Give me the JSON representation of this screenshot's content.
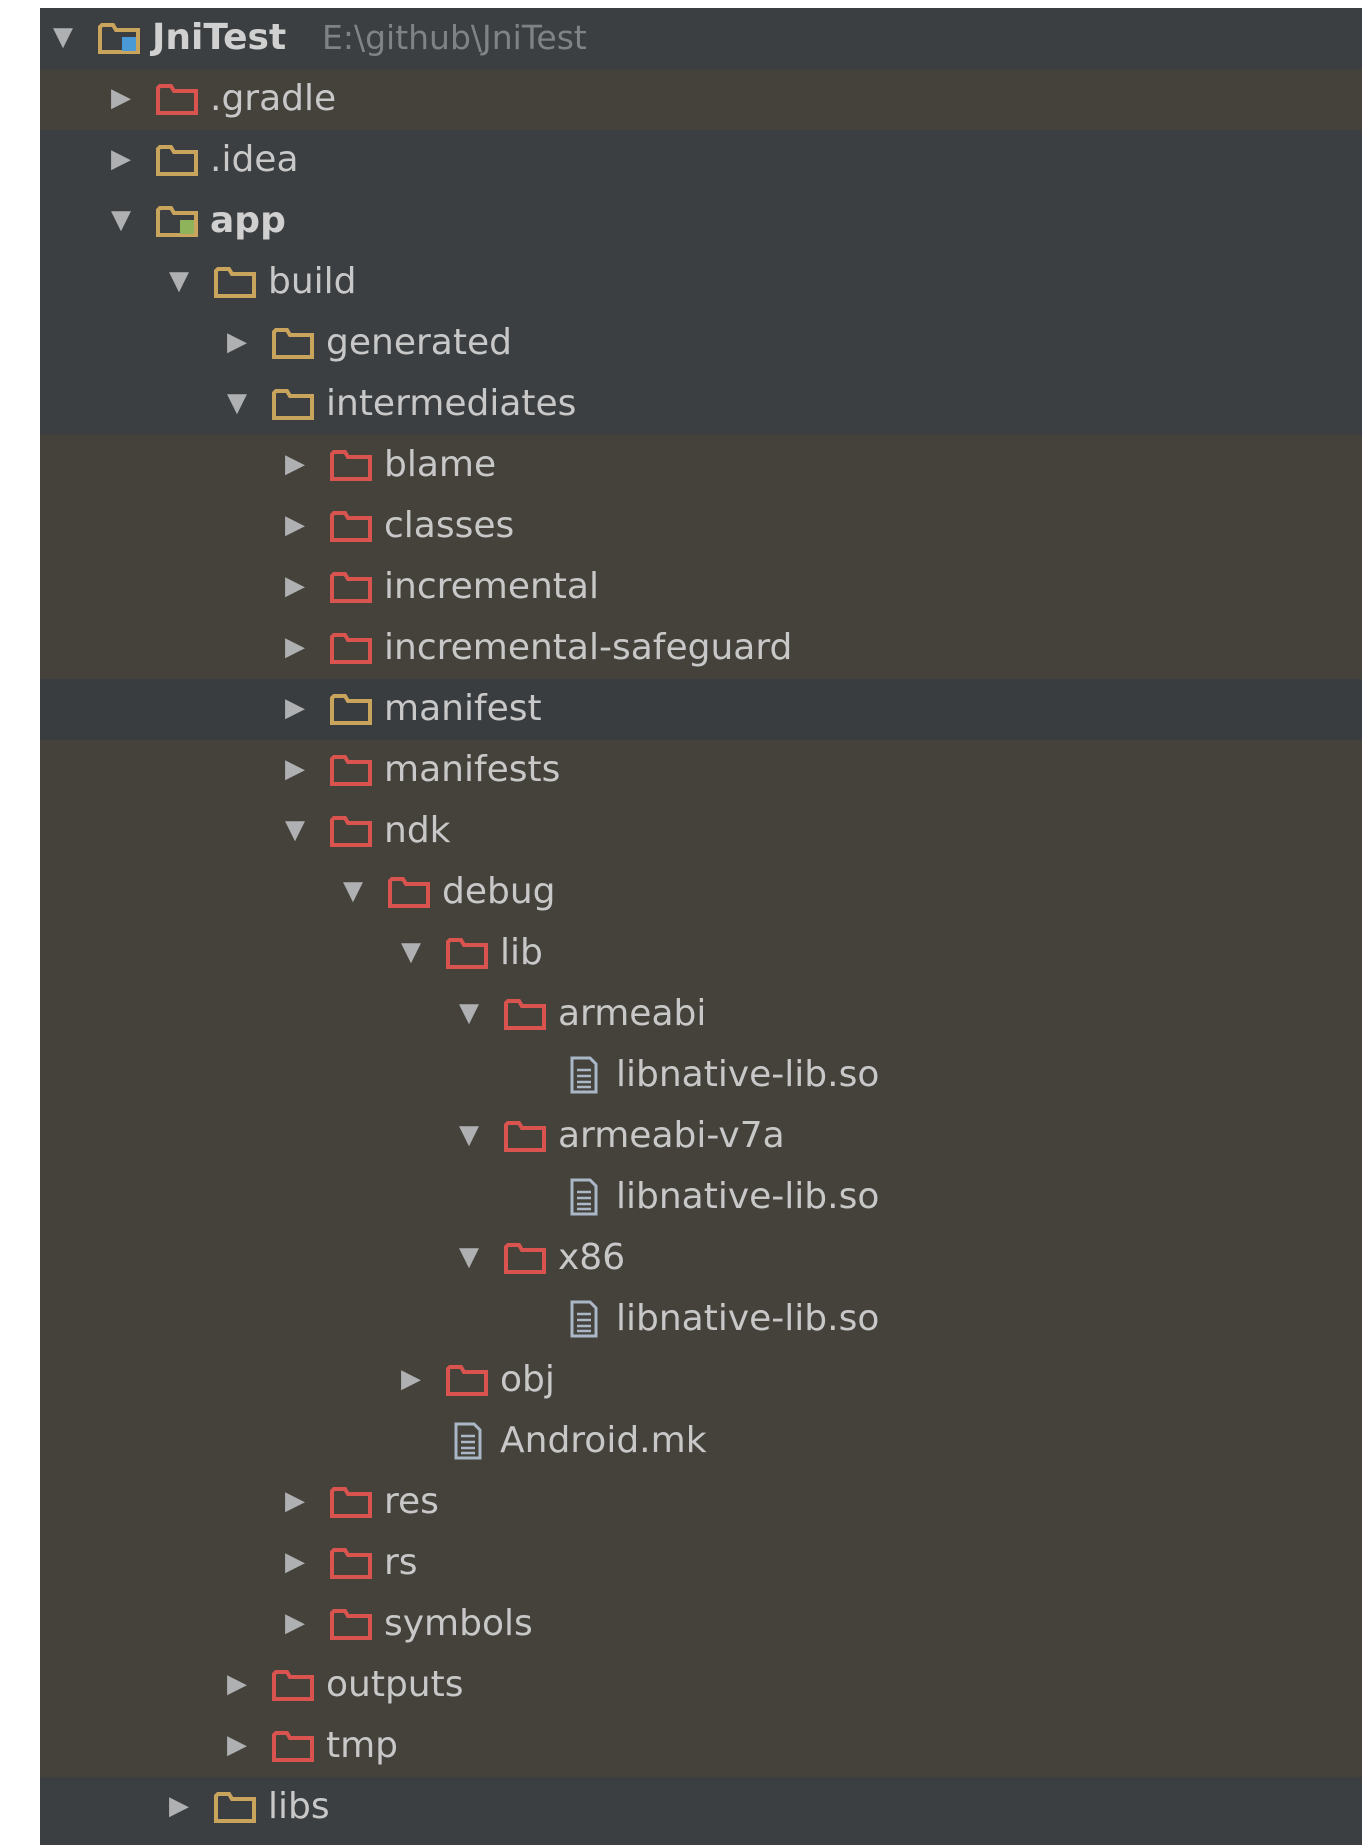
{
  "project": {
    "name": "JniTest",
    "path": "E:\\github\\JniTest"
  },
  "colors": {
    "panel_bg": "#3c3f41",
    "tint_bg": "#45423b",
    "folder_plain": "#c9a45c",
    "folder_excluded": "#d9534f",
    "file_icon": "#a9b7c6",
    "highlight_border": "#c0392b"
  },
  "tree": [
    {
      "label": "JniTest",
      "depth": 0,
      "state": "expanded",
      "icon": "project-module-icon",
      "bold": true
    },
    {
      "label": ".gradle",
      "depth": 1,
      "state": "collapsed",
      "icon": "folder-excluded-icon"
    },
    {
      "label": ".idea",
      "depth": 1,
      "state": "collapsed",
      "icon": "folder-icon"
    },
    {
      "label": "app",
      "depth": 1,
      "state": "expanded",
      "icon": "android-module-icon",
      "bold": true
    },
    {
      "label": "build",
      "depth": 2,
      "state": "expanded",
      "icon": "folder-icon"
    },
    {
      "label": "generated",
      "depth": 3,
      "state": "collapsed",
      "icon": "folder-icon"
    },
    {
      "label": "intermediates",
      "depth": 3,
      "state": "expanded",
      "icon": "folder-icon"
    },
    {
      "label": "blame",
      "depth": 4,
      "state": "collapsed",
      "icon": "folder-excluded-icon"
    },
    {
      "label": "classes",
      "depth": 4,
      "state": "collapsed",
      "icon": "folder-excluded-icon"
    },
    {
      "label": "incremental",
      "depth": 4,
      "state": "collapsed",
      "icon": "folder-excluded-icon"
    },
    {
      "label": "incremental-safeguard",
      "depth": 4,
      "state": "collapsed",
      "icon": "folder-excluded-icon"
    },
    {
      "label": "manifest",
      "depth": 4,
      "state": "collapsed",
      "icon": "folder-icon",
      "selected": true
    },
    {
      "label": "manifests",
      "depth": 4,
      "state": "collapsed",
      "icon": "folder-excluded-icon"
    },
    {
      "label": "ndk",
      "depth": 4,
      "state": "expanded",
      "icon": "folder-excluded-icon"
    },
    {
      "label": "debug",
      "depth": 5,
      "state": "expanded",
      "icon": "folder-excluded-icon"
    },
    {
      "label": "lib",
      "depth": 6,
      "state": "expanded",
      "icon": "folder-excluded-icon"
    },
    {
      "label": "armeabi",
      "depth": 7,
      "state": "expanded",
      "icon": "folder-excluded-icon"
    },
    {
      "label": "libnative-lib.so",
      "depth": 8,
      "state": "leaf",
      "icon": "file-icon"
    },
    {
      "label": "armeabi-v7a",
      "depth": 7,
      "state": "expanded",
      "icon": "folder-excluded-icon"
    },
    {
      "label": "libnative-lib.so",
      "depth": 8,
      "state": "leaf",
      "icon": "file-icon"
    },
    {
      "label": "x86",
      "depth": 7,
      "state": "expanded",
      "icon": "folder-excluded-icon"
    },
    {
      "label": "libnative-lib.so",
      "depth": 8,
      "state": "leaf",
      "icon": "file-icon"
    },
    {
      "label": "obj",
      "depth": 6,
      "state": "collapsed",
      "icon": "folder-excluded-icon"
    },
    {
      "label": "Android.mk",
      "depth": 6,
      "state": "leaf",
      "icon": "file-icon"
    },
    {
      "label": "res",
      "depth": 4,
      "state": "collapsed",
      "icon": "folder-excluded-icon"
    },
    {
      "label": "rs",
      "depth": 4,
      "state": "collapsed",
      "icon": "folder-excluded-icon"
    },
    {
      "label": "symbols",
      "depth": 4,
      "state": "collapsed",
      "icon": "folder-excluded-icon"
    },
    {
      "label": "outputs",
      "depth": 3,
      "state": "collapsed",
      "icon": "folder-excluded-icon"
    },
    {
      "label": "tmp",
      "depth": 3,
      "state": "collapsed",
      "icon": "folder-excluded-icon"
    },
    {
      "label": "libs",
      "depth": 2,
      "state": "collapsed",
      "icon": "folder-icon"
    }
  ]
}
